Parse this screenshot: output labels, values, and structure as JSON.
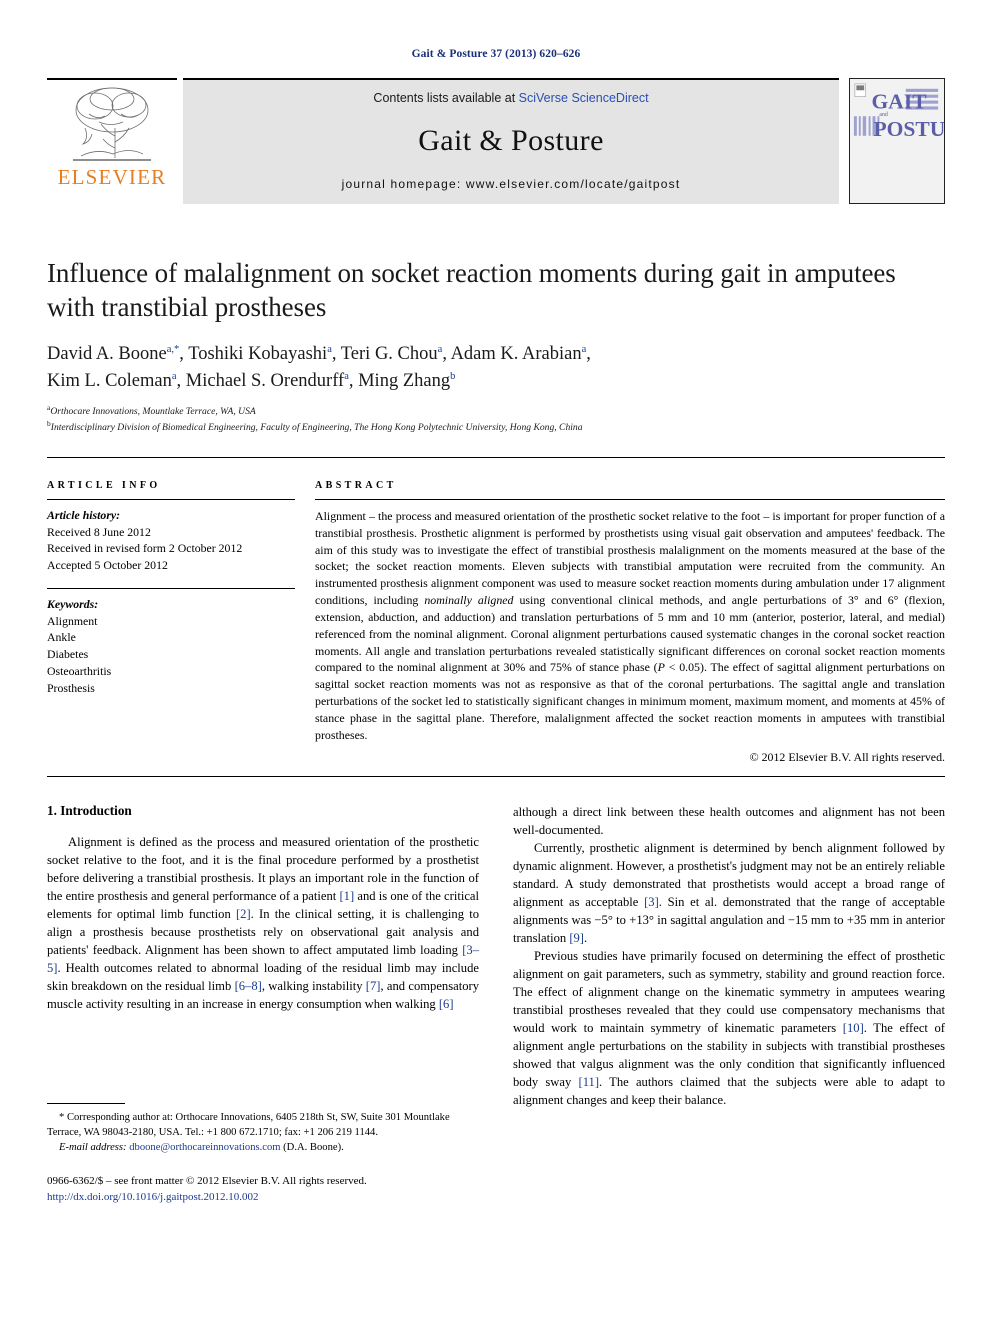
{
  "running_head": "Gait & Posture 37 (2013) 620–626",
  "masthead": {
    "publisher_name": "ELSEVIER",
    "contents_prefix": "Contents lists available at ",
    "sciencedirect": "SciVerse ScienceDirect",
    "journal_title": "Gait & Posture",
    "homepage": "journal homepage: www.elsevier.com/locate/gaitpost",
    "cover_line1": "GAIT",
    "cover_and": "and",
    "cover_line2": "POSTURE"
  },
  "article": {
    "title": "Influence of malalignment on socket reaction moments during gait in amputees with transtibial prostheses",
    "authors_line1": "David A. Boone",
    "authors_line1_sup": "a,*",
    "authors": [
      {
        "name": "David A. Boone",
        "sup": "a,*"
      },
      {
        "name": "Toshiki Kobayashi",
        "sup": "a"
      },
      {
        "name": "Teri G. Chou",
        "sup": "a"
      },
      {
        "name": "Adam K. Arabian",
        "sup": "a"
      },
      {
        "name": "Kim L. Coleman",
        "sup": "a"
      },
      {
        "name": "Michael S. Orendurff",
        "sup": "a"
      },
      {
        "name": "Ming Zhang",
        "sup": "b"
      }
    ],
    "affiliation_a": "Orthocare Innovations, Mountlake Terrace, WA, USA",
    "affiliation_a_mark": "a",
    "affiliation_b": "Interdisciplinary Division of Biomedical Engineering, Faculty of Engineering, The Hong Kong Polytechnic University, Hong Kong, China",
    "affiliation_b_mark": "b"
  },
  "info": {
    "label": "ARTICLE INFO",
    "history_heading": "Article history:",
    "history": [
      "Received 8 June 2012",
      "Received in revised form 2 October 2012",
      "Accepted 5 October 2012"
    ],
    "keywords_heading": "Keywords:",
    "keywords": [
      "Alignment",
      "Ankle",
      "Diabetes",
      "Osteoarthritis",
      "Prosthesis"
    ]
  },
  "abstract": {
    "label": "ABSTRACT",
    "part1": "Alignment – the process and measured orientation of the prosthetic socket relative to the foot – is important for proper function of a transtibial prosthesis. Prosthetic alignment is performed by prosthetists using visual gait observation and amputees' feedback. The aim of this study was to investigate the effect of transtibial prosthesis malalignment on the moments measured at the base of the socket; the socket reaction moments. Eleven subjects with transtibial amputation were recruited from the community. An instrumented prosthesis alignment component was used to measure socket reaction moments during ambulation under 17 alignment conditions, including ",
    "italic1": "nominally aligned",
    "part2": " using conventional clinical methods, and angle perturbations of 3° and 6° (flexion, extension, abduction, and adduction) and translation perturbations of 5 mm and 10 mm (anterior, posterior, lateral, and medial) referenced from the nominal alignment. Coronal alignment perturbations caused systematic changes in the coronal socket reaction moments. All angle and translation perturbations revealed statistically significant differences on coronal socket reaction moments compared to the nominal alignment at 30% and 75% of stance phase (",
    "italic2": "P",
    "part3": " < 0.05). The effect of sagittal alignment perturbations on sagittal socket reaction moments was not as responsive as that of the coronal perturbations. The sagittal angle and translation perturbations of the socket led to statistically significant changes in minimum moment, maximum moment, and moments at 45% of stance phase in the sagittal plane. Therefore, malalignment affected the socket reaction moments in amputees with transtibial prostheses.",
    "copyright": "© 2012 Elsevier B.V. All rights reserved."
  },
  "introduction": {
    "heading": "1. Introduction",
    "left_para1_a": "Alignment is defined as the process and measured orientation of the prosthetic socket relative to the foot, and it is the final procedure performed by a prosthetist before delivering a transtibial prosthesis. It plays an important role in the function of the entire prosthesis and general performance of a patient ",
    "left_ref1": "[1]",
    "left_para1_b": " and is one of the critical elements for optimal limb function ",
    "left_ref2": "[2]",
    "left_para1_c": ". In the clinical setting, it is challenging to align a prosthesis because prosthetists rely on observational gait analysis and patients' feedback. Alignment has been shown to affect amputated limb loading ",
    "left_ref3": "[3–5]",
    "left_para1_d": ". Health outcomes related to abnormal loading of the residual limb may include skin breakdown on the residual limb ",
    "left_ref4": "[6–8]",
    "left_para1_e": ", walking instability ",
    "left_ref5": "[7]",
    "left_para1_f": ", and compensatory muscle activity resulting in an increase in energy consumption when walking ",
    "left_ref6": "[6]",
    "right_para1": "although a direct link between these health outcomes and alignment has not been well-documented.",
    "right_para2_a": "Currently, prosthetic alignment is determined by bench alignment followed by dynamic alignment. However, a prosthetist's judgment may not be an entirely reliable standard. A study demonstrated that prosthetists would accept a broad range of alignment as acceptable ",
    "right_ref3": "[3]",
    "right_para2_b": ". Sin et al. demonstrated that the range of acceptable alignments was −5° to +13° in sagittal angulation and −15 mm to +35 mm in anterior translation ",
    "right_ref9": "[9]",
    "right_para2_c": ".",
    "right_para3_a": "Previous studies have primarily focused on determining the effect of prosthetic alignment on gait parameters, such as symmetry, stability and ground reaction force. The effect of alignment change on the kinematic symmetry in amputees wearing transtibial prostheses revealed that they could use compensatory mechanisms that would work to maintain symmetry of kinematic parameters ",
    "right_ref10": "[10]",
    "right_para3_b": ". The effect of alignment angle perturbations on the stability in subjects with transtibial prostheses showed that valgus alignment was the only condition that significantly influenced body sway ",
    "right_ref11": "[11]",
    "right_para3_c": ". The authors claimed that the subjects were able to adapt to alignment changes and keep their balance."
  },
  "footnotes": {
    "corresponding_mark": "*",
    "corresponding": " Corresponding author at: Orthocare Innovations, 6405 218th St, SW, Suite 301 Mountlake Terrace, WA 98043-2180, USA. Tel.: +1 800 672.1710; fax: +1 206 219 1144.",
    "email_label": "E-mail address:",
    "email": "dboone@orthocareinnovations.com",
    "email_suffix": " (D.A. Boone).",
    "issn_line": "0966-6362/$ – see front matter © 2012 Elsevier B.V. All rights reserved.",
    "doi": "http://dx.doi.org/10.1016/j.gaitpost.2012.10.002"
  },
  "colors": {
    "elsevier_orange": "#e87d1e",
    "link_blue": "#1a3a8f",
    "sciencedirect_blue": "#2a4fb5",
    "masthead_gray": "#e4e4e4",
    "cover_purple": "#8a8cc0"
  }
}
